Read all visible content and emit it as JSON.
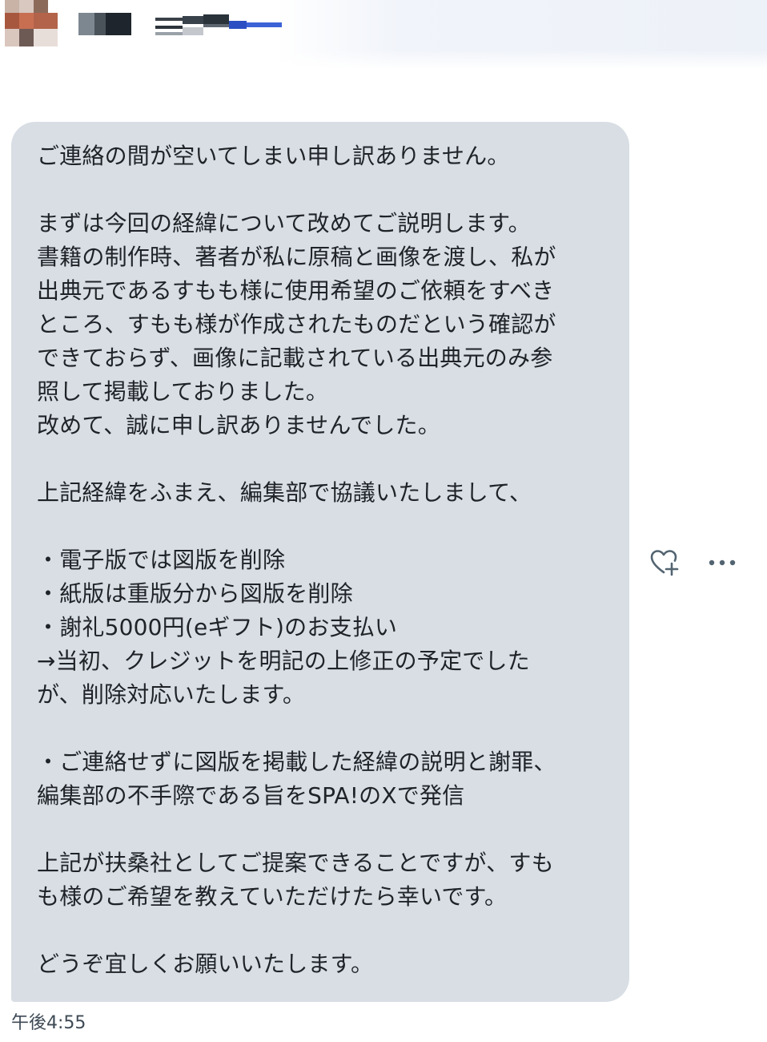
{
  "message": {
    "lines": [
      "ご連絡の間が空いてしまい申し訳ありません。",
      "",
      "まずは今回の経緯について改めてご説明します。",
      "書籍の制作時、著者が私に原稿と画像を渡し、私が",
      "出典元であるすもも様に使用希望のご依頼をすべき",
      "ところ、すもも様が作成されたものだという確認が",
      "できておらず、画像に記載されている出典元のみ参",
      "照して掲載しておりました。",
      "改めて、誠に申し訳ありませんでした。",
      "",
      "上記経緯をふまえ、編集部で協議いたしまして、",
      "",
      "・電子版では図版を削除",
      "・紙版は重版分から図版を削除",
      "・謝礼5000円(eギフト)のお支払い",
      "→当初、クレジットを明記の上修正の予定でした",
      "が、削除対応いたします。",
      "",
      "・ご連絡せずに図版を掲載した経緯の説明と謝罪、",
      "編集部の不手際である旨をSPA!のXで発信",
      "",
      "上記が扶桑社としてご提案できることですが、すも",
      "も様のご希望を教えていただけたら幸いです。",
      "",
      "どうぞ宜しくお願いいたします。"
    ],
    "timestamp": "午後4:55"
  },
  "actions": {
    "react_icon": "heart-plus-icon",
    "more_icon": "more-horizontal-icon"
  },
  "colors": {
    "bubble_background": "#d8dee4",
    "text": "#1f2328",
    "icon": "#536471",
    "timestamp": "#3e4a55",
    "header_fade": "#edf1f8"
  }
}
